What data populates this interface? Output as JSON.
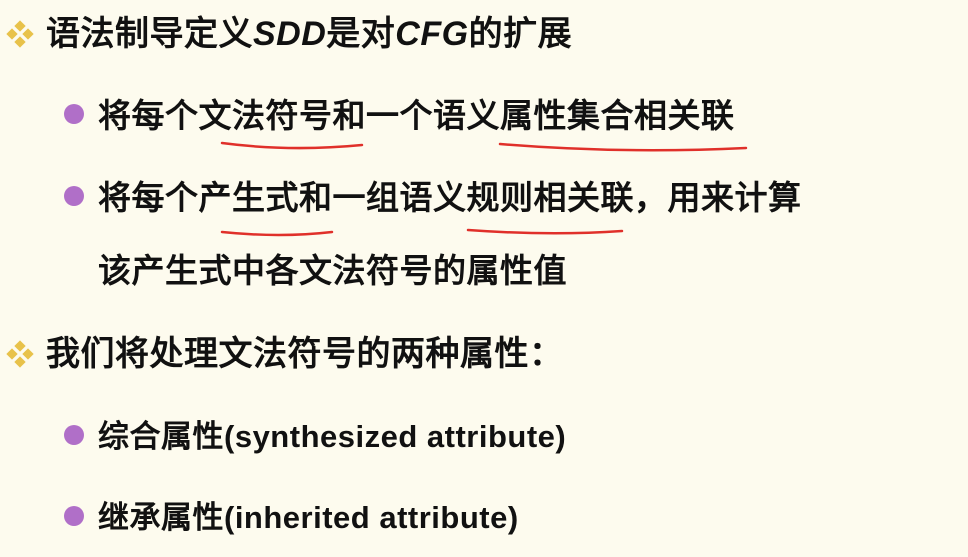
{
  "bullets": [
    {
      "level": 1,
      "parts": [
        {
          "t": "语法制导定义"
        },
        {
          "t": "SDD",
          "italic": true
        },
        {
          "t": "是对"
        },
        {
          "t": "CFG",
          "italic": true
        },
        {
          "t": "的扩展"
        }
      ]
    },
    {
      "level": 2,
      "text": "将每个文法符号和一个语义属性集合相关联"
    },
    {
      "level": 2,
      "text": "将每个产生式和一组语义规则相关联，用来计算",
      "continuation": "该产生式中各文法符号的属性值"
    },
    {
      "level": 1,
      "text": "我们将处理文法符号的两种属性："
    },
    {
      "level": 2,
      "text": "综合属性(synthesized attribute)"
    },
    {
      "level": 2,
      "text": "继承属性(inherited attribute)"
    }
  ],
  "colors": {
    "background": "#fdfbee",
    "diamond": "#e8c24a",
    "dot": "#b06fc8",
    "underline": "#e0302a"
  },
  "icons": {
    "level1": "diamond-bullet-icon",
    "level2": "circle-bullet-icon"
  }
}
